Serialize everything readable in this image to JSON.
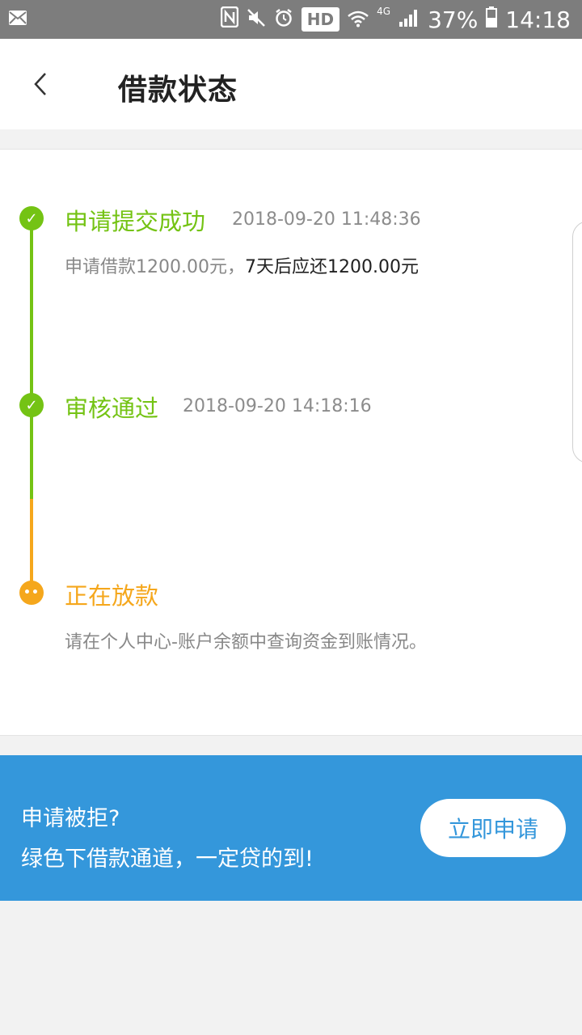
{
  "status_bar": {
    "hd": "HD",
    "network": "4G",
    "battery": "37%",
    "time": "14:18"
  },
  "header": {
    "title": "借款状态"
  },
  "steps": [
    {
      "title": "申请提交成功",
      "time": "2018-09-20 11:48:36",
      "desc_prefix": "申请借款1200.00元，",
      "desc_highlight": "7天后应还1200.00元",
      "status": "done"
    },
    {
      "title": "审核通过",
      "time": "2018-09-20 14:18:16",
      "status": "done"
    },
    {
      "title": "正在放款",
      "desc": "请在个人中心-账户余额中查询资金到账情况。",
      "status": "in-progress"
    }
  ],
  "banner": {
    "line1": "申请被拒?",
    "line2": "绿色下借款通道，一定贷的到!",
    "button": "立即申请"
  },
  "colors": {
    "green": "#74c314",
    "orange": "#f5a71c",
    "blue": "#3497db"
  }
}
